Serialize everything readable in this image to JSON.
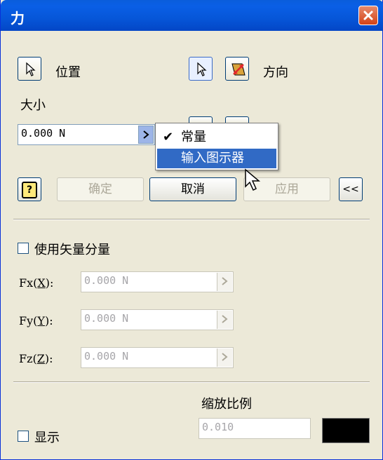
{
  "window": {
    "title": "力"
  },
  "position": {
    "label": "位置"
  },
  "direction": {
    "label": "方向"
  },
  "magnitude": {
    "label": "大小",
    "value": "0.000 N"
  },
  "menu": {
    "items": [
      "常量",
      "输入图示器"
    ],
    "checked_index": 0,
    "highlighted_index": 1
  },
  "buttons": {
    "help": "?",
    "ok": "确定",
    "cancel": "取消",
    "apply": "应用",
    "collapse": "<<"
  },
  "vector": {
    "checkbox_label": "使用矢量分量",
    "fx_label": "Fx",
    "fx_key": "X",
    "fx_value": "0.000 N",
    "fy_label": "Fy",
    "fy_key": "Y",
    "fy_value": "0.000 N",
    "fz_label": "Fz",
    "fz_key": "Z",
    "fz_value": "0.000 N"
  },
  "scale": {
    "label": "缩放比例",
    "value": "0.010"
  },
  "display": {
    "label": "显示",
    "checked": false
  },
  "colors": {
    "titlebar": "#0a5ddb",
    "menu_highlight": "#316ac5",
    "swatch": "#000000",
    "face": "#ece9d8"
  }
}
